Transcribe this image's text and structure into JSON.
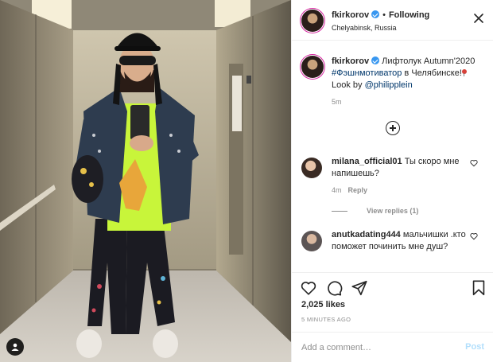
{
  "post_header": {
    "username": "fkirkorov",
    "separator": "•",
    "follow_status": "Following",
    "location": "Chelyabinsk, Russia"
  },
  "caption": {
    "username": "fkirkorov",
    "text_start": "Лифтолук Autumn'2020",
    "hashtag": "#Фэшнмотиватор",
    "text_mid": " в Челябинске!",
    "text_look": "Look by ",
    "mention": "@philipplein",
    "time": "5m"
  },
  "comments": [
    {
      "username": "milana_official01",
      "text": "Ты скоро мне напишешь?",
      "time": "4m",
      "reply_label": "Reply"
    },
    {
      "username": "anutkadating444",
      "text": "мальчишки .кто поможет починить мне душ?"
    }
  ],
  "view_replies_label": "View replies (1)",
  "likes": "2,025 likes",
  "time_ago": "5 MINUTES AGO",
  "add_comment": {
    "placeholder": "Add a comment…",
    "post_label": "Post"
  },
  "colors": {
    "verified": "#3897f0",
    "link": "#00376b",
    "post_disabled": "#b2dffc",
    "shirt": "#c8f53a"
  },
  "icons": [
    "close-icon",
    "more-comments-icon",
    "heart-icon",
    "comment-icon",
    "share-icon",
    "save-icon",
    "tag-user-icon",
    "verified-icon"
  ]
}
